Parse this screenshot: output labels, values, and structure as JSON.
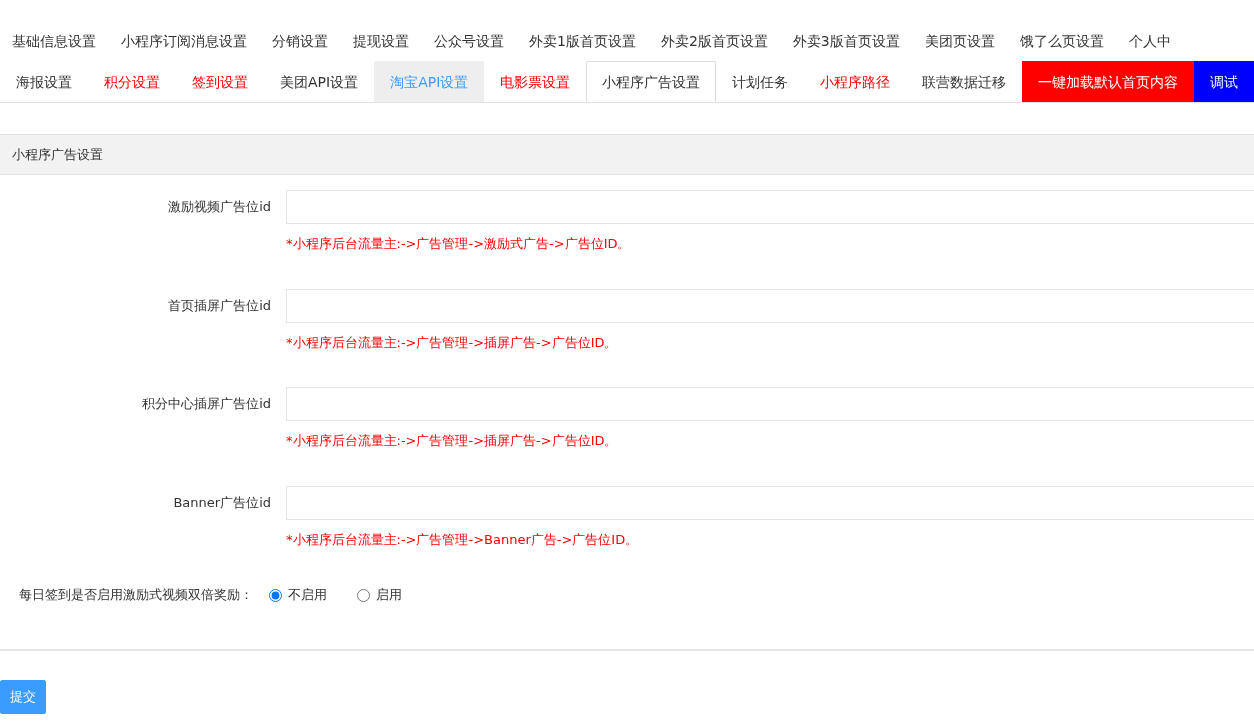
{
  "top_nav": [
    {
      "label": "基础信息设置"
    },
    {
      "label": "小程序订阅消息设置"
    },
    {
      "label": "分销设置"
    },
    {
      "label": "提现设置"
    },
    {
      "label": "公众号设置"
    },
    {
      "label": "外卖1版首页设置"
    },
    {
      "label": "外卖2版首页设置"
    },
    {
      "label": "外卖3版首页设置"
    },
    {
      "label": "美团页设置"
    },
    {
      "label": "饿了么页设置"
    },
    {
      "label": "个人中"
    }
  ],
  "tabs": [
    {
      "label": "海报设置",
      "kind": "tab",
      "color": "#333333",
      "selected": false,
      "hovered": false
    },
    {
      "label": "积分设置",
      "kind": "tab",
      "color": "#ff0000",
      "selected": false,
      "hovered": false
    },
    {
      "label": "签到设置",
      "kind": "tab",
      "color": "#ff0000",
      "selected": false,
      "hovered": false
    },
    {
      "label": "美团API设置",
      "kind": "tab",
      "color": "#333333",
      "selected": false,
      "hovered": false
    },
    {
      "label": "淘宝API设置",
      "kind": "tab",
      "color": "#3d9bff",
      "selected": false,
      "hovered": true
    },
    {
      "label": "电影票设置",
      "kind": "tab",
      "color": "#ff0000",
      "selected": false,
      "hovered": false
    },
    {
      "label": "小程序广告设置",
      "kind": "tab",
      "color": "#333333",
      "selected": true,
      "hovered": false
    },
    {
      "label": "计划任务",
      "kind": "tab",
      "color": "#333333",
      "selected": false,
      "hovered": false
    },
    {
      "label": "小程序路径",
      "kind": "tab",
      "color": "#ff0000",
      "selected": false,
      "hovered": false
    },
    {
      "label": "联营数据迁移",
      "kind": "tab",
      "color": "#333333",
      "selected": false,
      "hovered": false
    },
    {
      "label": "一键加载默认首页内容",
      "kind": "button",
      "color": "#ff0000"
    },
    {
      "label": "调试",
      "kind": "button",
      "color": "#0000ff"
    }
  ],
  "panel": {
    "title": "小程序广告设置",
    "fields": [
      {
        "label": "激励视频广告位id",
        "hint": "*小程序后台流量主:->广告管理->激励式广告->广告位ID。"
      },
      {
        "label": "首页插屏广告位id",
        "hint": "*小程序后台流量主:->广告管理->插屏广告->广告位ID。"
      },
      {
        "label": "积分中心插屏广告位id",
        "hint": "*小程序后台流量主:->广告管理->插屏广告->广告位ID。"
      },
      {
        "label": "Banner广告位id",
        "hint": "*小程序后台流量主:->广告管理->Banner广告->广告位ID。"
      }
    ],
    "radio_group": {
      "label": "每日签到是否启用激励式视频双倍奖励：",
      "options": [
        {
          "label": "不启用",
          "selected": true
        },
        {
          "label": "启用",
          "selected": false
        }
      ]
    }
  },
  "submit_button": "提交"
}
